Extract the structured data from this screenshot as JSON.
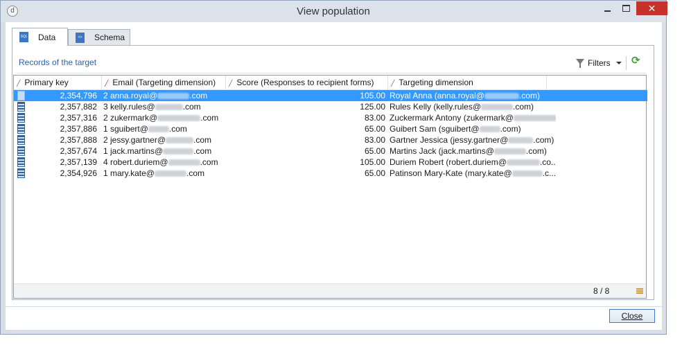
{
  "window": {
    "title": "View population",
    "app_icon_glyph": "d"
  },
  "tabs": [
    {
      "label": "Data",
      "icon": "sql-file-icon",
      "active": true
    },
    {
      "label": "Schema",
      "icon": "schema-file-icon",
      "active": false
    }
  ],
  "toolbar": {
    "records_link": "Records of the target",
    "filters_label": "Filters"
  },
  "grid": {
    "columns": [
      "Primary key",
      "Email (Targeting dimension)",
      "Score (Responses to recipient forms)",
      "Targeting dimension"
    ],
    "rows": [
      {
        "pk": "2,354,796",
        "email_pre": "2 anna.royal@",
        "email_post": ".com",
        "score": "105.00",
        "target_pre": "Royal Anna (anna.royal@",
        "target_post": ".com)",
        "selected": true
      },
      {
        "pk": "2,357,882",
        "email_pre": "3 kelly.rules@",
        "email_post": ".com",
        "score": "125.00",
        "target_pre": "Rules Kelly (kelly.rules@",
        "target_post": ".com)",
        "selected": false
      },
      {
        "pk": "2,357,316",
        "email_pre": "2 zukermark@",
        "email_post": ".com",
        "score": "83.00",
        "target_pre": "Zuckermark Antony (zukermark@",
        "target_post": "..",
        "selected": false
      },
      {
        "pk": "2,357,886",
        "email_pre": "1 sguibert@",
        "email_post": ".com",
        "score": "65.00",
        "target_pre": "Guibert Sam (sguibert@",
        "target_post": ".com)",
        "selected": false
      },
      {
        "pk": "2,357,888",
        "email_pre": "2 jessy.gartner@",
        "email_post": ".com",
        "score": "83.00",
        "target_pre": "Gartner Jessica (jessy.gartner@",
        "target_post": ".com)",
        "selected": false
      },
      {
        "pk": "2,357,674",
        "email_pre": "1 jack.martins@",
        "email_post": ".com",
        "score": "65.00",
        "target_pre": "Martins Jack (jack.martins@",
        "target_post": ".com)",
        "selected": false
      },
      {
        "pk": "2,357,139",
        "email_pre": "4 robert.duriem@",
        "email_post": ".com",
        "score": "105.00",
        "target_pre": "Duriem Robert (robert.duriem@",
        "target_post": ".co...",
        "selected": false
      },
      {
        "pk": "2,354,926",
        "email_pre": "1 mary.kate@",
        "email_post": ".com",
        "score": "65.00",
        "target_pre": "Patinson Mary-Kate (mary.kate@",
        "target_post": ".c...",
        "selected": false
      }
    ],
    "count": "8 / 8"
  },
  "footer": {
    "close_label": "Close"
  }
}
